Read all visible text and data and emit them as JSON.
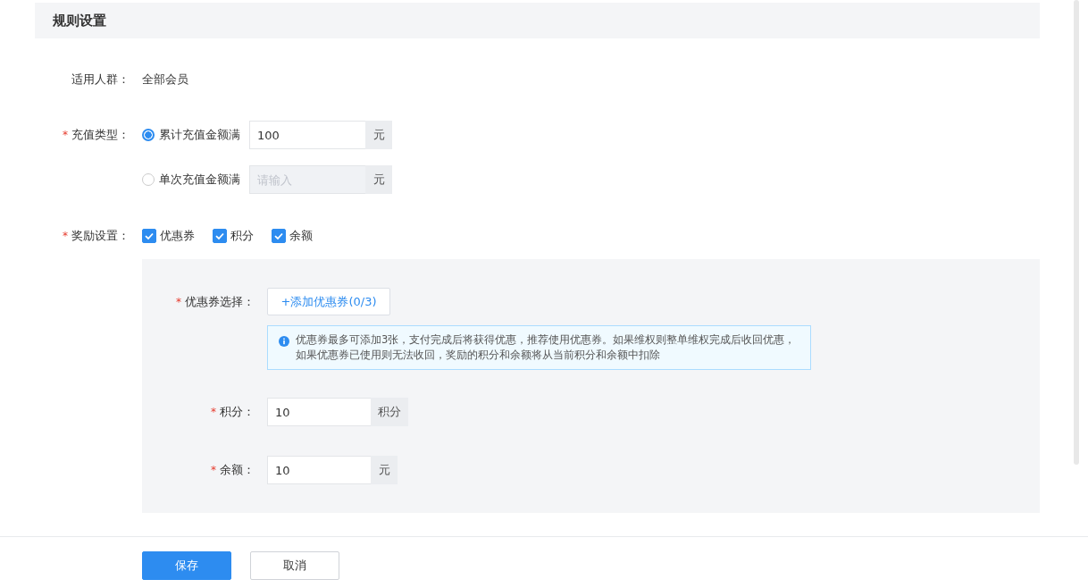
{
  "section_title": "规则设置",
  "audience": {
    "label": "适用人群：",
    "value": "全部会员"
  },
  "recharge_type": {
    "label": "充值类型：",
    "required_mark": "*",
    "options": [
      {
        "label": "累计充值金额满",
        "selected": true,
        "value": "100",
        "unit": "元"
      },
      {
        "label": "单次充值金额满",
        "selected": false,
        "placeholder": "请输入",
        "unit": "元"
      }
    ]
  },
  "rewards": {
    "label": "奖励设置：",
    "required_mark": "*",
    "options": [
      {
        "label": "优惠券",
        "checked": true
      },
      {
        "label": "积分",
        "checked": true
      },
      {
        "label": "余额",
        "checked": true
      }
    ]
  },
  "reward_panel": {
    "coupon": {
      "label": "优惠券选择：",
      "required_mark": "*",
      "button": "+添加优惠券(0/3)",
      "info": "优惠券最多可添加3张，支付完成后将获得优惠，推荐使用优惠券。如果维权则整单维权完成后收回优惠，如果优惠券已使用则无法收回，奖励的积分和余额将从当前积分和余额中扣除"
    },
    "fields": [
      {
        "label": "积分：",
        "required_mark": "*",
        "value": "10",
        "unit": "积分"
      },
      {
        "label": "余额：",
        "required_mark": "*",
        "value": "10",
        "unit": "元"
      }
    ]
  },
  "buttons": {
    "save": "保存",
    "cancel": "取消"
  }
}
